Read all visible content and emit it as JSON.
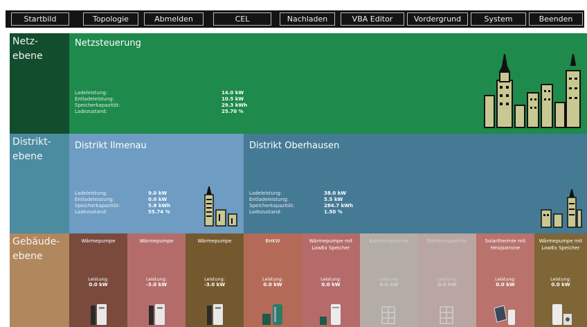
{
  "menu": [
    "Startbild",
    "Topologie",
    "Abmelden",
    "CEL",
    "Nachladen",
    "VBA Editor",
    "Vordergrund",
    "System",
    "Beenden"
  ],
  "levels": {
    "net": [
      "Netz-",
      "ebene"
    ],
    "district": [
      "Distrikt-",
      "ebene"
    ],
    "building": [
      "Gebäude-",
      "ebene"
    ]
  },
  "labels": {
    "charge_power": "Ladeleistung:",
    "discharge_power": "Entladeleistung:",
    "capacity": "Speicherkapazität:",
    "state": "Ladezustand:",
    "power": "Leistung:"
  },
  "grid": {
    "title": "Netzsteuerung",
    "charge_power": "14.0 kW",
    "discharge_power": "10.5 kW",
    "capacity": "29.3 kWh",
    "state": "25.70 %"
  },
  "districts": [
    {
      "title": "Distrikt Ilmenau",
      "charge_power": "9.0 kW",
      "discharge_power": "0.0 kW",
      "capacity": "5.8 kWh",
      "state": "55.74 %"
    },
    {
      "title": "Distrikt Oberhausen",
      "charge_power": "38.0 kW",
      "discharge_power": "5.5 kW",
      "capacity": "284.7 kWh",
      "state": "1.50 %"
    }
  ],
  "buildings": [
    {
      "name": "Wärmepumpe",
      "value": "0.0 kW",
      "color": "#7a4a3d",
      "icon": "heat-pump-icon"
    },
    {
      "name": "Wärmepumpe",
      "value": "-3.0 kW",
      "color": "#b46c6b",
      "icon": "heat-pump-icon"
    },
    {
      "name": "Wärmepumpe",
      "value": "-3.0 kW",
      "color": "#75592e",
      "icon": "heat-pump-icon"
    },
    {
      "name": "BHKW",
      "value": "0.0 kW",
      "color": "#b36b57",
      "icon": "chp-icon"
    },
    {
      "name": "Wärmepumpe mit LowEx Speicher",
      "value": "0.0 kW",
      "color": "#b46b6a",
      "icon": "heat-pump-storage-icon"
    },
    {
      "name": "Batteriespeicher",
      "value": "0.0 kW",
      "color": "#b3ada6",
      "icon": "battery-icon"
    },
    {
      "name": "Batteriespeicher",
      "value": "0.0 kW",
      "color": "#b9a5a1",
      "icon": "battery-icon"
    },
    {
      "name": "Solarthermie mit Heizpatrone",
      "value": "0.0 kW",
      "color": "#b9726c",
      "icon": "solar-thermal-icon"
    },
    {
      "name": "Wärmepumpe mit LowEx Speicher",
      "value": "0.0 kW",
      "color": "#7f6637",
      "icon": "heat-pump-storage-icon"
    }
  ],
  "colors": {
    "grid_bg": "#1e8a4b",
    "grid_label_bg": "#124d2d",
    "district_label_bg": "#4c8ca1",
    "district1_bg": "#6e9cc2",
    "district2_bg": "#457a95",
    "building_label_bg": "#b1875d"
  }
}
